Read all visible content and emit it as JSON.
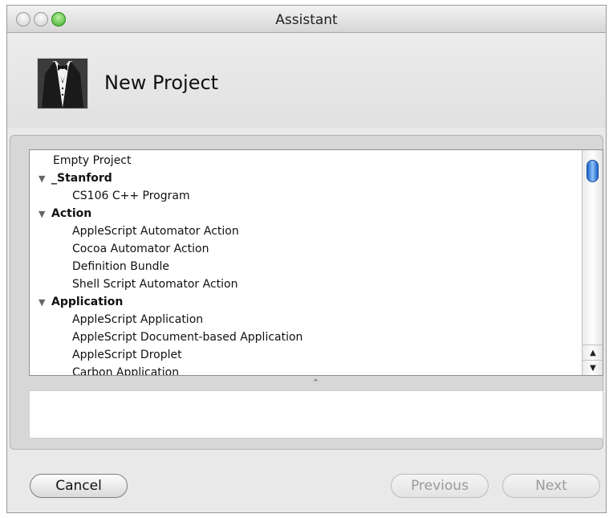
{
  "window": {
    "title": "Assistant"
  },
  "header": {
    "title": "New Project",
    "icon": "tuxedo-icon"
  },
  "template_list": {
    "rows": [
      {
        "label": "Empty Project",
        "level": 0,
        "group": false
      },
      {
        "label": "_Stanford",
        "level": 0,
        "group": true
      },
      {
        "label": "CS106 C++ Program",
        "level": 1,
        "group": false
      },
      {
        "label": "Action",
        "level": 0,
        "group": true
      },
      {
        "label": "AppleScript Automator Action",
        "level": 1,
        "group": false
      },
      {
        "label": "Cocoa Automator Action",
        "level": 1,
        "group": false
      },
      {
        "label": "Definition Bundle",
        "level": 1,
        "group": false
      },
      {
        "label": "Shell Script Automator Action",
        "level": 1,
        "group": false
      },
      {
        "label": "Application",
        "level": 0,
        "group": true
      },
      {
        "label": "AppleScript Application",
        "level": 1,
        "group": false
      },
      {
        "label": "AppleScript Document-based Application",
        "level": 1,
        "group": false
      },
      {
        "label": "AppleScript Droplet",
        "level": 1,
        "group": false
      },
      {
        "label": "Carbon Application",
        "level": 1,
        "group": false
      }
    ],
    "disclosure_glyph": "▼",
    "split_glyph": "⌃",
    "scroll_up_glyph": "▲",
    "scroll_down_glyph": "▼"
  },
  "description": {
    "text": ""
  },
  "buttons": {
    "cancel": "Cancel",
    "previous": "Previous",
    "next": "Next"
  },
  "colors": {
    "accent": "#1c63c9",
    "zoom_button": "#3fae2a"
  }
}
